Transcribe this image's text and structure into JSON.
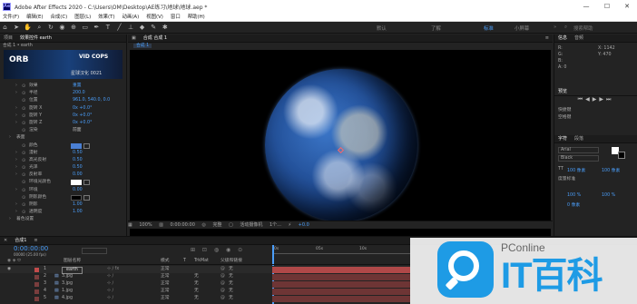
{
  "window": {
    "title": "Adobe After Effects 2020 - C:\\Users\\OM\\Desktop\\AE练习\\地球\\地球.aep *",
    "app_badge": "Ae"
  },
  "menu": [
    "文件(F)",
    "编辑(E)",
    "合成(C)",
    "图层(L)",
    "效果(T)",
    "动画(A)",
    "视图(V)",
    "窗口",
    "帮助(H)"
  ],
  "workspaces": [
    "默认",
    "了解",
    "标准",
    "小屏幕"
  ],
  "workspace_active": "标准",
  "search_placeholder": "搜索帮助",
  "left_panel": {
    "tabs": [
      "项目",
      "效果控件 earth"
    ],
    "breadcrumb": "合成 1 • earth",
    "promo_text_1": "ORB",
    "promo_text_2": "VID COPS",
    "promo_text_3": "星球汉化 0021",
    "rows": [
      {
        "label": "效果",
        "value": "重置"
      },
      {
        "label": "半径",
        "value": "200.0"
      },
      {
        "label": "位置",
        "value": "961.0, 540.0, 0.0"
      },
      {
        "label": "旋转 X",
        "value": "0x +0.0°"
      },
      {
        "label": "旋转 Y",
        "value": "0x +0.0°"
      },
      {
        "label": "旋转 Z",
        "value": "0x +0.0°"
      },
      {
        "label": "渲染",
        "value": "前面"
      },
      {
        "label": "表面",
        "value": ""
      },
      {
        "label": "颜色",
        "value": ""
      },
      {
        "label": "漫射",
        "value": "0.50"
      },
      {
        "label": "高光反射",
        "value": "0.50"
      },
      {
        "label": "光泽",
        "value": "0.50"
      },
      {
        "label": "反射率",
        "value": "0.00"
      },
      {
        "label": "环境光颜色",
        "value": ""
      },
      {
        "label": "环境",
        "value": "0.00"
      },
      {
        "label": "阴影颜色",
        "value": ""
      },
      {
        "label": "阴影",
        "value": "1.00"
      },
      {
        "label": "透明度",
        "value": "1.00"
      },
      {
        "label": "着色设置",
        "value": ""
      }
    ]
  },
  "viewer": {
    "tab": "合成 合成 1",
    "subtab": "合成 1",
    "zoom": "100%",
    "timecode": "0:00:00:00",
    "resolution": "完整",
    "camera": "活动摄像机",
    "views": "1个...",
    "exposure": "+0.0"
  },
  "right_panel": {
    "info_tab": "信息",
    "audio_tab": "音频",
    "info_x": "X: 1142",
    "info_y": "Y: 470",
    "info_lines": [
      "R:",
      "G:",
      "B:",
      "A: 0"
    ],
    "preview_title": "预览",
    "preview_shortcut_label": "快捷键",
    "preview_shortcut": "空格键",
    "char_tab": "字符",
    "para_tab": "段落",
    "font": "Arial",
    "font_style": "Black",
    "size": "100 像素",
    "leading": "100 像素",
    "kern": "度量标准",
    "scale_v": "100 %",
    "scale_h": "100 %",
    "baseline": "0 像素"
  },
  "timeline": {
    "tab": "合成1",
    "timecode": "0:00:00:00",
    "frame_sub": "00000 (25.00 fps)",
    "headers": [
      "图层名称",
      "模式",
      "T",
      "TrkMat",
      "父级和链接"
    ],
    "ruler": [
      "0s",
      "05s",
      "10s"
    ],
    "layers": [
      {
        "num": "1",
        "name": "earth",
        "mode": "正常",
        "trkmat": "",
        "parent": "无",
        "color": "#c24b4b"
      },
      {
        "num": "2",
        "name": "3.jpg",
        "mode": "正常",
        "trkmat": "无",
        "parent": "无",
        "color": "#7a3d3d"
      },
      {
        "num": "3",
        "name": "3.jpg",
        "mode": "正常",
        "trkmat": "无",
        "parent": "无",
        "color": "#7a3d3d"
      },
      {
        "num": "4",
        "name": "1.jpg",
        "mode": "正常",
        "trkmat": "无",
        "parent": "无",
        "color": "#7a3d3d"
      },
      {
        "num": "5",
        "name": "4.jpg",
        "mode": "正常",
        "trkmat": "无",
        "parent": "无",
        "color": "#7a3d3d"
      }
    ]
  },
  "watermark": {
    "brand": "PConline",
    "name": "IT百科"
  },
  "colors": {
    "accent": "#4a9df8",
    "layer_label": "#c24b4b",
    "brand": "#1e9be5"
  }
}
